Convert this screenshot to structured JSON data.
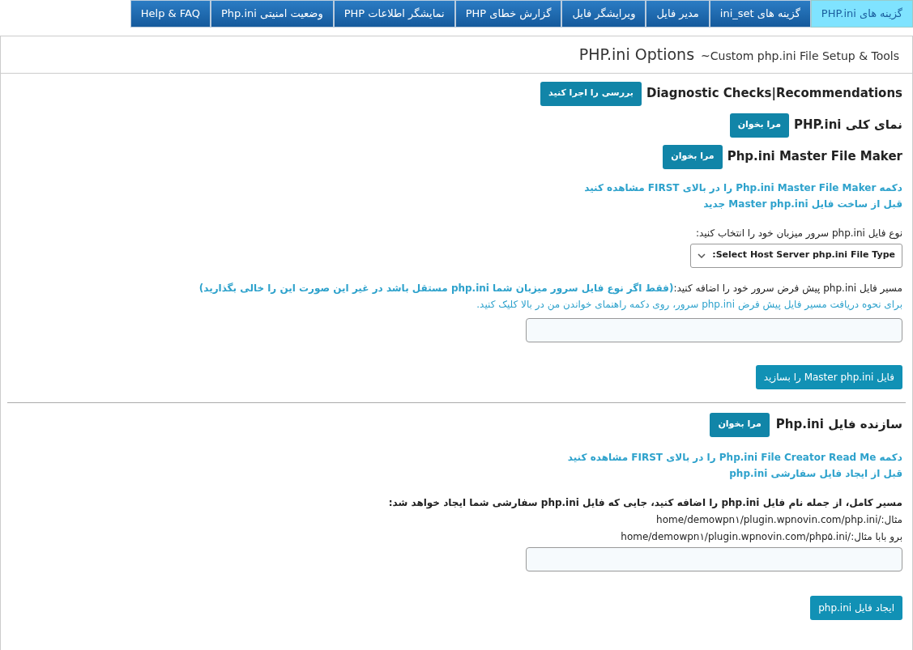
{
  "tabs": [
    {
      "label": "گزینه های PHP.ini",
      "selected": true
    },
    {
      "label": "گزینه های ini_set",
      "selected": false
    },
    {
      "label": "مدیر فایل",
      "selected": false
    },
    {
      "label": "ویرایشگر فایل",
      "selected": false
    },
    {
      "label": "گزارش خطای PHP",
      "selected": false
    },
    {
      "label": "نمایشگر اطلاعات PHP",
      "selected": false
    },
    {
      "label": "وضعیت امنیتی Php.ini",
      "selected": false
    },
    {
      "label": "Help & FAQ",
      "selected": false
    }
  ],
  "header": {
    "title": "PHP.ini Options",
    "subtitle": "~Custom php.ini File Setup & Tools"
  },
  "tools": [
    {
      "label": "Diagnostic Checks|Recommendations",
      "button": "بررسی را اجرا کنید"
    },
    {
      "label": "نمای کلی PHP.ini",
      "button": "مرا بخوان"
    },
    {
      "label": "Php.ini Master File Maker",
      "button": "مرا بخوان"
    }
  ],
  "master_notes": [
    "دکمه Php.ini Master File Maker را در بالای FIRST مشاهده کنید",
    "قبل از ساخت فایل Master php.ini جدید"
  ],
  "host_type": {
    "label": "نوع فایل php.ini سرور میزبان خود را انتخاب کنید:",
    "value": "Select Host Server php.ini File Type:"
  },
  "default_path": {
    "label": "مسیر فایل php.ini پیش فرض سرور خود را اضافه کنید:",
    "note": "(فقط اگر نوع فایل سرور میزبان شما php.ini مستقل باشد در غیر این صورت این را خالی بگذارید)",
    "help": "برای نحوه دریافت مسیر فایل پیش فرض php.ini سرور، روی دکمه راهنمای خواندن من در بالا کلیک کنید."
  },
  "master_button": "فایل Master php.ini را بسازید",
  "creator": {
    "label": "سازنده فایل Php.ini",
    "button": "مرا بخوان"
  },
  "creator_notes": [
    "دکمه Php.ini File Creator Read Me را در بالای FIRST مشاهده کنید",
    "قبل از ایجاد فایل سفارشی php.ini"
  ],
  "full_path": {
    "label": "مسیر کامل، از جمله نام فایل php.ini را اضافه کنید، جایی که فایل php.ini سفارشی شما ایجاد خواهد شد:",
    "examples": [
      "مثال:/home/demowpn۱/plugin.wpnovin.com/php.ini",
      "برو بابا مثال:/home/demowpn۱/plugin.wpnovin.com/php۵.ini"
    ]
  },
  "create_button": "ایجاد فایل php.ini"
}
